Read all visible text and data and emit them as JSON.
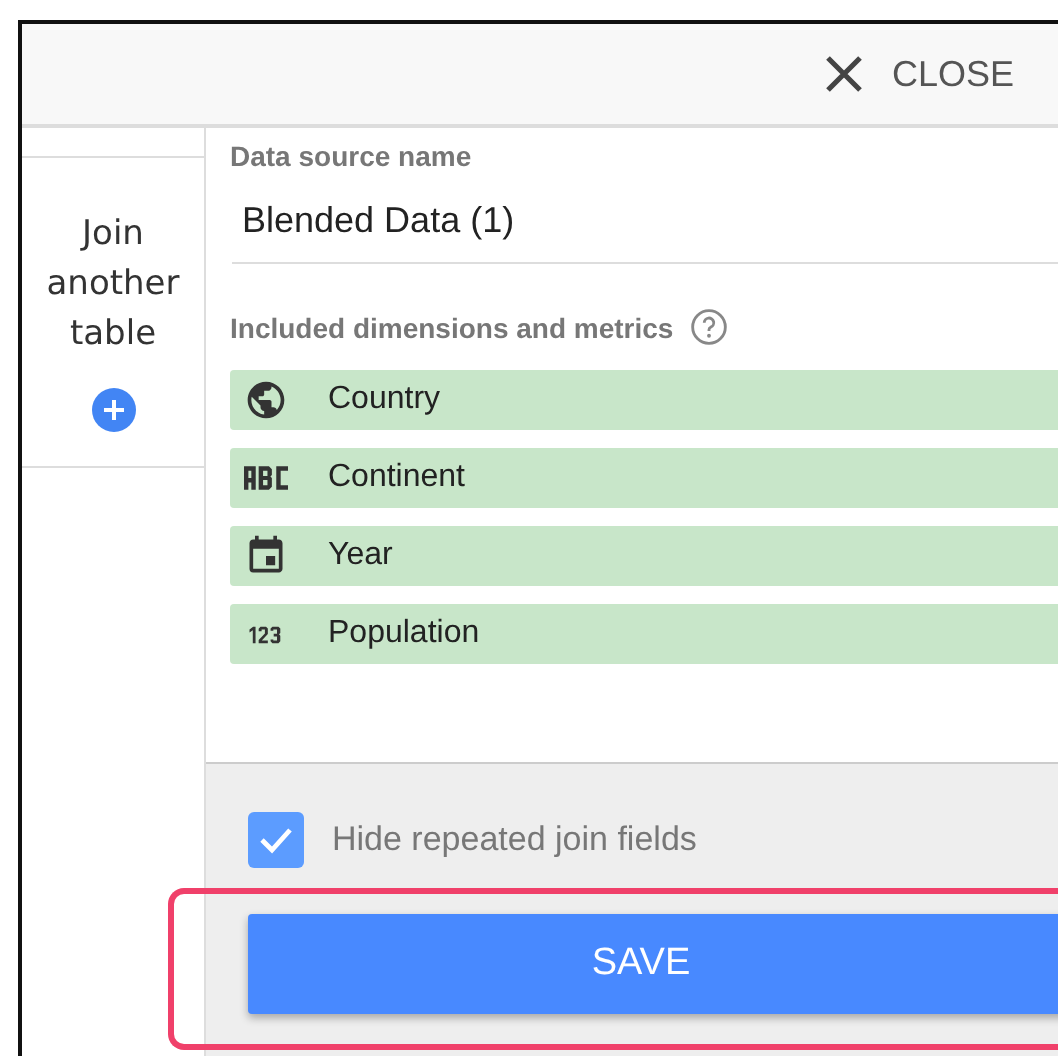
{
  "header": {
    "close_label": "CLOSE"
  },
  "sidebar": {
    "join_label": "Join another table"
  },
  "data_source": {
    "label": "Data source name",
    "value": "Blended Data (1)"
  },
  "fields_section": {
    "title": "Included dimensions and metrics"
  },
  "fields": [
    {
      "kind": "geo",
      "name": "Country"
    },
    {
      "kind": "text",
      "name": "Continent"
    },
    {
      "kind": "date",
      "name": "Year"
    },
    {
      "kind": "number",
      "name": "Population"
    }
  ],
  "hide_repeated": {
    "label": "Hide repeated join fields",
    "checked": true
  },
  "save_label": "SAVE"
}
